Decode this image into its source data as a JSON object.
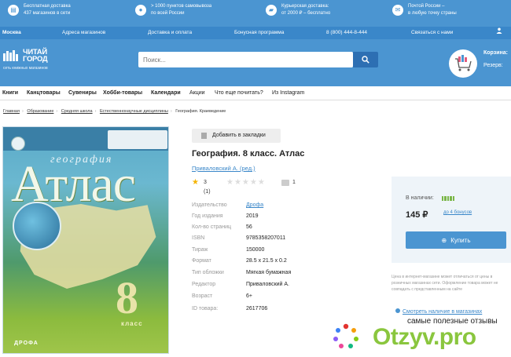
{
  "promo": [
    {
      "icon": "book-icon",
      "text1": "Бесплатная доставка",
      "text2": "437 магазинов в сети"
    },
    {
      "icon": "pin-icon",
      "text1": "> 1000 пунктов самовывоза",
      "text2": "по всей России"
    },
    {
      "icon": "truck-icon",
      "text1": "Курьерская доставка:",
      "text2": "от 2000 ₽ – бесплатно"
    },
    {
      "icon": "mail-icon",
      "text1": "Почтой России –",
      "text2": "в любую точку страны"
    }
  ],
  "cityrow": {
    "city": "Москва",
    "stores": "Адреса магазинов",
    "delivery": "Доставка и оплата",
    "bonus": "Бонусная программа",
    "phone": "8 (800) 444-8-444",
    "contact": "Связаться с нами"
  },
  "logo": {
    "line1": "ЧИТАЙ",
    "line2": "ГОРОД",
    "sub": "сеть книжных магазинов"
  },
  "search": {
    "placeholder": "Поиск..."
  },
  "cart": {
    "label": "Корзина:",
    "sub": "Резерв:"
  },
  "nav": [
    "Книги",
    "Канцтовары",
    "Сувениры",
    "Хобби-товары",
    "Календари",
    "Акции",
    "Что еще почитать?",
    "Из Instagram"
  ],
  "breadcrumbs": [
    "Главная",
    "Образование",
    "Средняя школа",
    "Естественнонаучные дисциплины",
    "География. Краеведение"
  ],
  "cover": {
    "geo": "география",
    "atlas": "Атлас",
    "grade": "8",
    "klass": "класс",
    "publisher": "ДРОФА"
  },
  "product": {
    "bookmark": "Добавить в закладки",
    "title": "География. 8 класс. Атлас",
    "author": "Приваловский А. (ред.)",
    "rating": "3 (1)",
    "reviews": "1"
  },
  "props": [
    {
      "k": "Издательство",
      "v": "Дрофа"
    },
    {
      "k": "Год издания",
      "v": "2019"
    },
    {
      "k": "Кол-во страниц",
      "v": "56"
    },
    {
      "k": "ISBN",
      "v": "9785358207011"
    },
    {
      "k": "Тираж",
      "v": "150000"
    },
    {
      "k": "Формат",
      "v": "28.5 x 21.5 x 0.2"
    },
    {
      "k": "Тип обложки",
      "v": "Мягкая бумажная"
    },
    {
      "k": "Редактор",
      "v": "Приваловский А."
    },
    {
      "k": "Возраст",
      "v": "6+"
    },
    {
      "k": "ID товара:",
      "v": "2617706"
    }
  ],
  "buy": {
    "instock": "В наличии:",
    "price": "145 ₽",
    "bonus": "до 4 бонусов",
    "button": "Купить",
    "note": "Цена в интернет-магазине может отличаться от цены в розничных магазинах сети. Оформление товара может не совпадать с представленным на сайте",
    "stores": "Смотреть наличие в магазинах"
  },
  "watermark": {
    "tagline": "самые полезные отзывы",
    "brand": "Otzyv.pro"
  },
  "colors": {
    "primary": "#4b95d1",
    "dark": "#3a87c9",
    "stock": "#7ab648",
    "star": "#f5b400"
  }
}
